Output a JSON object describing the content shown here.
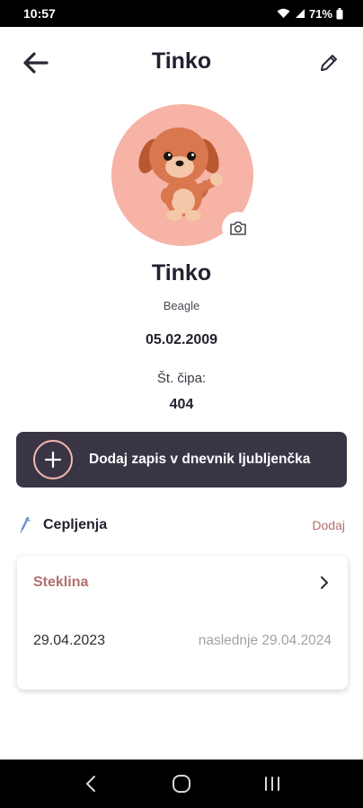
{
  "status_bar": {
    "time": "10:57",
    "battery": "71%"
  },
  "header": {
    "title": "Tinko"
  },
  "pet": {
    "name": "Tinko",
    "breed": "Beagle",
    "dob": "05.02.2009",
    "chip_label": "Št. čipa:",
    "chip_value": "404"
  },
  "add_record": {
    "label": "Dodaj zapis v dnevnik ljubljenčka"
  },
  "vaccinations": {
    "title": "Cepljenja",
    "add_label": "Dodaj",
    "items": [
      {
        "name": "Steklina",
        "date": "29.04.2023",
        "next": "naslednje 29.04.2024"
      }
    ]
  },
  "colors": {
    "accent": "#b2706d",
    "dark": "#3a3545",
    "avatar_bg": "#f6b3a6",
    "plus_ring": "#f5b9ac"
  },
  "icons": [
    "back-arrow-icon",
    "pencil-icon",
    "camera-icon",
    "plus-icon",
    "syringe-icon",
    "chevron-right-icon",
    "wifi-icon",
    "signal-icon",
    "battery-icon"
  ]
}
